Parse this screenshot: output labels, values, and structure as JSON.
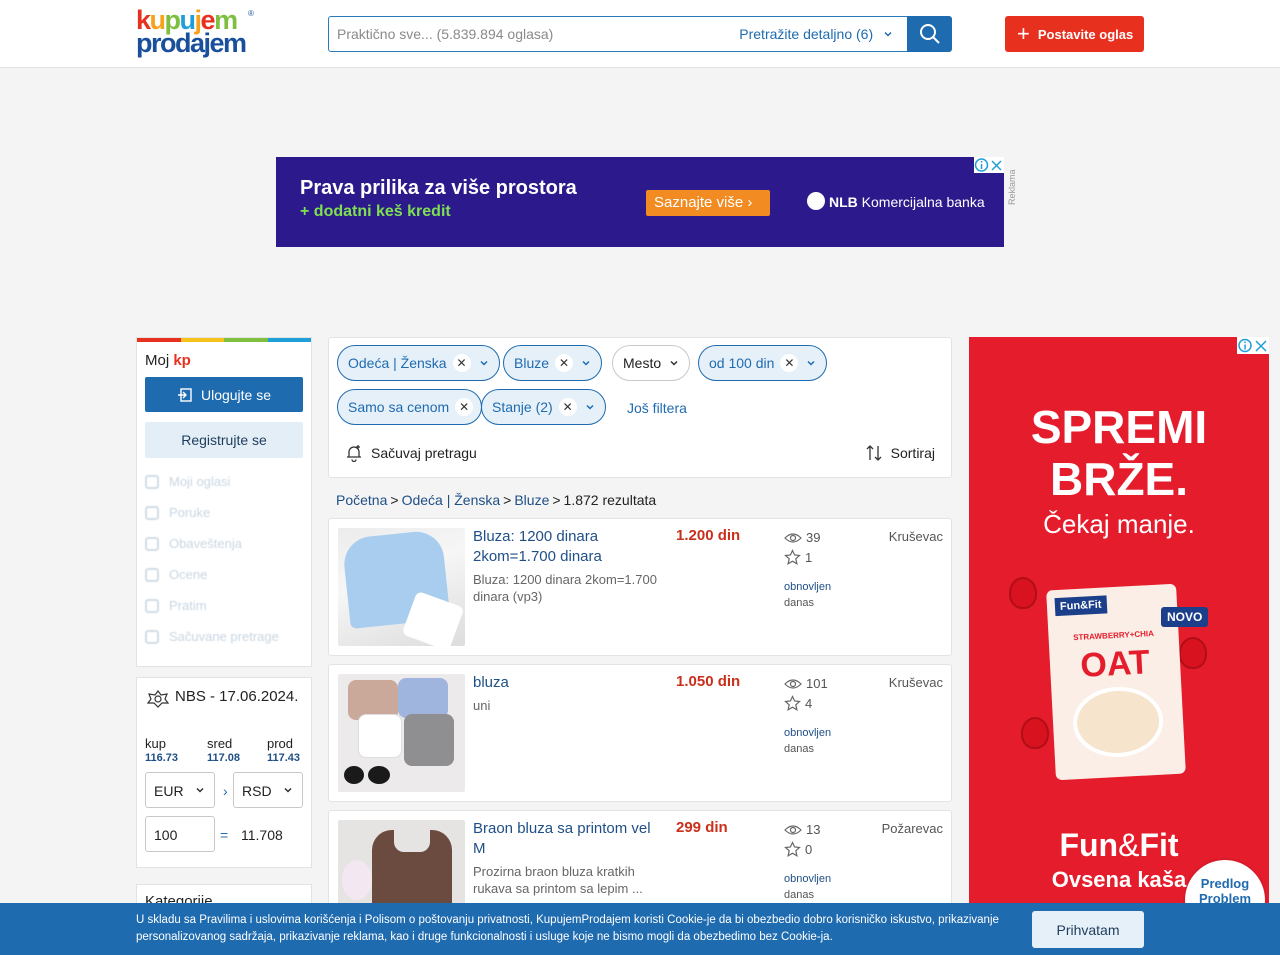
{
  "header": {
    "logo_line1": [
      "k",
      "u",
      "p",
      "u",
      "j",
      "e",
      "m"
    ],
    "logo_line2": "prodajem",
    "logo_reg": "®",
    "search_placeholder": "Praktično sve... (5.839.894 oglasa)",
    "detail_search": "Pretražite detaljno (6)",
    "post_ad": "Postavite oglas"
  },
  "colors": {
    "brand_blue": "#1f6bb0",
    "accent_red": "#e8301f",
    "price_red": "#c9301c",
    "logo_letters": [
      "#e8301f",
      "#f7a21b",
      "#7fbf3f",
      "#1f9fd8",
      "#f7a21b",
      "#e8301f",
      "#7fbf3f"
    ],
    "stripe": [
      "#e8301f",
      "#f7c21b",
      "#7fbf3f",
      "#1f9fd8"
    ]
  },
  "banner_ad": {
    "line1": "Prava prilika za više prostora",
    "line2": "+ dodatni keš kredit",
    "cta": "Saznajte više",
    "bank_bold": "NLB",
    "bank_rest": "Komercijalna banka",
    "label": "Reklama"
  },
  "sidebar": {
    "moj": "Moj",
    "moj_kp": "kp",
    "login": "Ulogujte se",
    "register": "Registrujte se",
    "items": [
      "Moji oglasi",
      "Poruke",
      "Obaveštenja",
      "Ocene",
      "Pratim",
      "Sačuvane pretrage"
    ]
  },
  "nbs": {
    "title": "NBS - 17.06.2024.",
    "kup_label": "kup",
    "kup_value": "116.73",
    "sred_label": "sred",
    "sred_value": "117.08",
    "prod_label": "prod",
    "prod_value": "117.43",
    "from_currency": "EUR",
    "arrow": "›",
    "to_currency": "RSD",
    "amount": "100",
    "equals": "=",
    "result": "11.708"
  },
  "categories_title": "Kategorije",
  "filters": {
    "chips": [
      {
        "label": "Odeća | Ženska",
        "active": true,
        "removable": true
      },
      {
        "label": "Bluze",
        "active": true,
        "removable": true
      },
      {
        "label": "Mesto",
        "active": false,
        "removable": false
      },
      {
        "label": "od 100 din",
        "active": true,
        "removable": true
      },
      {
        "label": "Samo sa cenom",
        "active": true,
        "removable": true
      },
      {
        "label": "Stanje (2)",
        "active": true,
        "removable": true
      }
    ],
    "more": "Još filtera",
    "save_search": "Sačuvaj pretragu",
    "sort": "Sortiraj"
  },
  "breadcrumb": {
    "home": "Početna",
    "cat": "Odeća | Ženska",
    "sub": "Bluze",
    "sep": ">",
    "count": "1.872 rezultata"
  },
  "listings": [
    {
      "title": "Bluza: 1200 dinara 2kom=1.700 dinara",
      "desc": "Bluza: 1200 dinara 2kom=1.700 dinara (vp3)",
      "price": "1.200 din",
      "views": "39",
      "favs": "1",
      "renewed": "obnovljen",
      "when": "danas",
      "city": "Kruševac"
    },
    {
      "title": "bluza",
      "desc": "uni",
      "price": "1.050 din",
      "views": "101",
      "favs": "4",
      "renewed": "obnovljen",
      "when": "danas",
      "city": "Kruševac"
    },
    {
      "title": "Braon bluza sa printom vel M",
      "desc": "Prozirna braon bluza kratkih rukava sa printom sa lepim ...",
      "price": "299 din",
      "views": "13",
      "favs": "0",
      "renewed": "obnovljen",
      "when": "danas",
      "city": "Požarevac"
    }
  ],
  "side_ad": {
    "line1": "SPREMI",
    "line2": "BRŽE.",
    "line3": "Čekaj manje.",
    "pack_brand": "Fun&Fit",
    "pack_flavor": "STRAWBERRY+CHIA",
    "pack_oat": "OAT",
    "novo": "NOVO",
    "brand_fun": "Fun",
    "brand_amp": "&",
    "brand_fit": "Fit",
    "product": "Ovsena kaša"
  },
  "report_problem": [
    "Predlog",
    "Problem"
  ],
  "cookie": {
    "text": "U skladu sa Pravilima i uslovima korišćenja i Polisom o poštovanju privatnosti, KupujemProdajem koristi Cookie-je da bi obezbedio dobro korisničko iskustvo, prikazivanje personalizovanog sadržaja, prikazivanje reklama, kao i druge funkcionalnosti i usluge koje ne bismo mogli da obezbedimo bez Cookie-ja.",
    "accept": "Prihvatam"
  }
}
